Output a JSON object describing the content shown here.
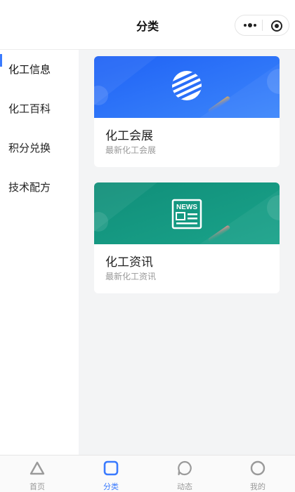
{
  "header": {
    "title": "分类"
  },
  "sidebar": {
    "items": [
      {
        "label": "化工信息",
        "active": true
      },
      {
        "label": "化工百科",
        "active": false
      },
      {
        "label": "积分兑换",
        "active": false
      },
      {
        "label": "技术配方",
        "active": false
      }
    ]
  },
  "cards": [
    {
      "title": "化工会展",
      "subtitle": "最新化工会展",
      "icon": "globe-icon",
      "color": "#2a6ef8"
    },
    {
      "title": "化工资讯",
      "subtitle": "最新化工资讯",
      "icon": "news-icon",
      "color": "#139b82",
      "icon_text": "NEWS"
    }
  ],
  "tabbar": {
    "tabs": [
      {
        "label": "首页",
        "icon": "triangle-icon",
        "active": false
      },
      {
        "label": "分类",
        "icon": "square-icon",
        "active": true
      },
      {
        "label": "动态",
        "icon": "chat-bubble-icon",
        "active": false
      },
      {
        "label": "我的",
        "icon": "circle-icon",
        "active": false
      }
    ]
  },
  "colors": {
    "accent": "#3a7afe",
    "background": "#f3f4f5"
  }
}
